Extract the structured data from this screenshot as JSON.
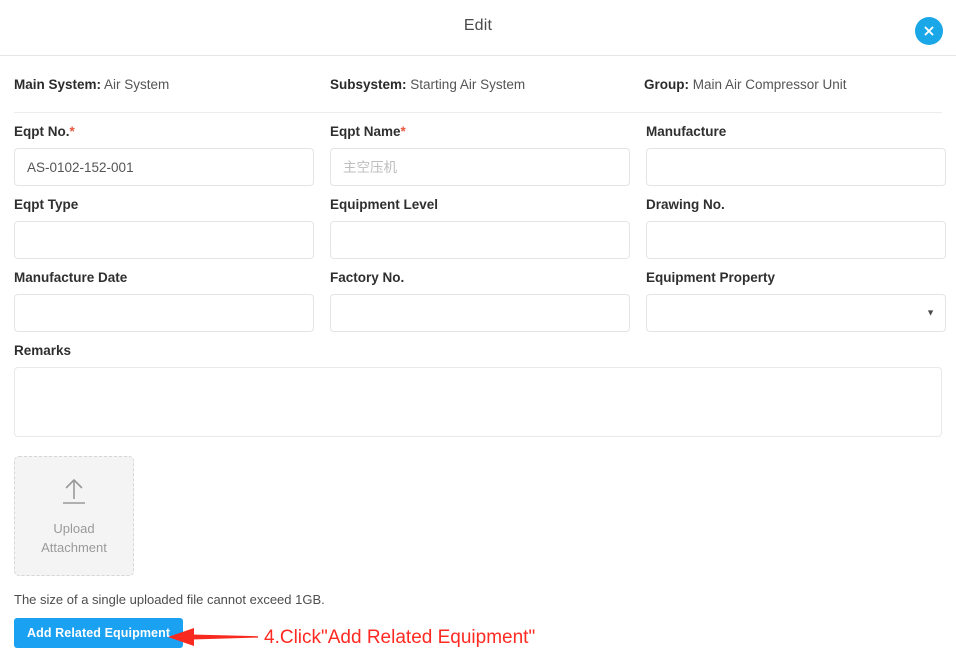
{
  "modal": {
    "title": "Edit",
    "close_label": "×",
    "close_icon": "close-icon",
    "accent_color": "#19a7e8"
  },
  "info": [
    {
      "label": "Main System",
      "separator": ":",
      "value": "Air System"
    },
    {
      "label": "Subsystem",
      "separator": ":",
      "value": "Starting Air System"
    },
    {
      "label": "Group",
      "separator": ":",
      "value": "Main Air Compressor Unit"
    }
  ],
  "form": {
    "eqpt_no": {
      "label": "Eqpt No.",
      "required_mark": "*",
      "value": "AS-0102-152-001",
      "placeholder": ""
    },
    "eqpt_name": {
      "label": "Eqpt Name",
      "required_mark": "*",
      "value": "",
      "placeholder": "主空压机"
    },
    "manufacture": {
      "label": "Manufacture",
      "value": "",
      "placeholder": ""
    },
    "eqpt_type": {
      "label": "Eqpt Type",
      "value": "",
      "placeholder": ""
    },
    "equipment_level": {
      "label": "Equipment Level",
      "value": "",
      "placeholder": ""
    },
    "drawing_no": {
      "label": "Drawing No.",
      "value": "",
      "placeholder": ""
    },
    "manufacture_date": {
      "label": "Manufacture Date",
      "value": "",
      "placeholder": ""
    },
    "factory_no": {
      "label": "Factory No.",
      "value": "",
      "placeholder": ""
    },
    "equipment_property": {
      "label": "Equipment Property",
      "selected": "",
      "arrow_icon": "chevron-down-icon"
    },
    "remarks": {
      "label": "Remarks",
      "value": "",
      "placeholder": ""
    }
  },
  "upload": {
    "icon": "upload-arrow-icon",
    "line1": "Upload",
    "line2": "Attachment",
    "hint": "The size of a single uploaded file cannot exceed 1GB."
  },
  "actions": {
    "add_related_equipment": "Add Related Equipment",
    "button_color": "#1ba1f2"
  },
  "annotation": {
    "text": "4.Click\"Add Related Equipment\"",
    "color": "#ff2a22",
    "arrow_icon": "left-arrow-annotation-icon"
  }
}
